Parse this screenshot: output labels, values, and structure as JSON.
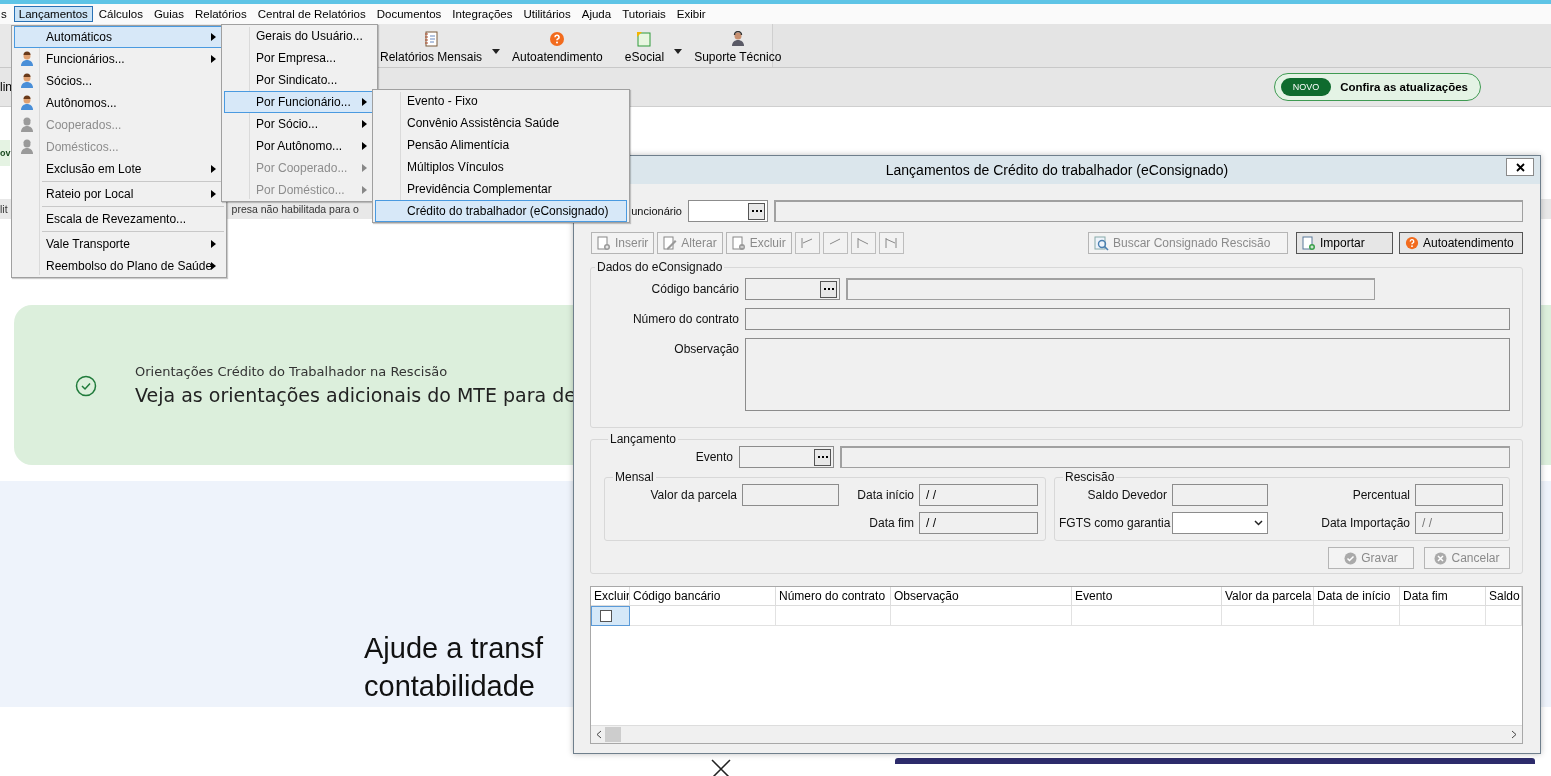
{
  "menubar": [
    {
      "label": "s",
      "selected": false
    },
    {
      "label": "Lançamentos",
      "selected": true
    },
    {
      "label": "Cálculos",
      "selected": false
    },
    {
      "label": "Guias",
      "selected": false
    },
    {
      "label": "Relatórios",
      "selected": false
    },
    {
      "label": "Central de Relatórios",
      "selected": false
    },
    {
      "label": "Documentos",
      "selected": false
    },
    {
      "label": "Integrações",
      "selected": false
    },
    {
      "label": "Utilitários",
      "selected": false
    },
    {
      "label": "Ajuda",
      "selected": false
    },
    {
      "label": "Tutoriais",
      "selected": false
    },
    {
      "label": "Exibir",
      "selected": false
    }
  ],
  "toolbar": [
    {
      "label": "Relatórios Mensais",
      "kind": "report",
      "dropdown": true
    },
    {
      "label": "Autoatendimento",
      "kind": "help",
      "dropdown": false
    },
    {
      "label": "eSocial",
      "kind": "esocial",
      "dropdown": true
    },
    {
      "label": "Suporte Técnico",
      "kind": "support",
      "dropdown": false
    }
  ],
  "info_bar": {
    "left_text": "lin",
    "badge": "NOVO",
    "link": "Confira as atualizações"
  },
  "page": {
    "notice_fragment": "ov",
    "warning_fragments": [
      "lit",
      "presa não habilitada para o"
    ],
    "card": {
      "title": "Orientações Crédito do Trabalhador na Rescisão",
      "text": "Veja as orientações adicionais do MTE para de"
    },
    "promo_lines": [
      "Ajude a transf",
      "contabilidade"
    ]
  },
  "menus": [
    {
      "items": [
        {
          "kind": "item",
          "label": "Automáticos",
          "submenu": true,
          "disabled": false,
          "selected": true
        },
        {
          "kind": "person",
          "label": "Funcionários...",
          "submenu": true,
          "disabled": false,
          "selected": false
        },
        {
          "kind": "person",
          "label": "Sócios...",
          "submenu": false,
          "disabled": false,
          "selected": false
        },
        {
          "kind": "person",
          "label": "Autônomos...",
          "submenu": false,
          "disabled": false,
          "selected": false
        },
        {
          "kind": "person",
          "label": "Cooperados...",
          "submenu": false,
          "disabled": true,
          "selected": false
        },
        {
          "kind": "person",
          "label": "Domésticos...",
          "submenu": false,
          "disabled": true,
          "selected": false
        },
        {
          "kind": "item",
          "label": "Exclusão em Lote",
          "submenu": true,
          "disabled": false,
          "selected": false
        },
        {
          "kind": "separator"
        },
        {
          "kind": "item",
          "label": "Rateio por Local",
          "submenu": true,
          "disabled": false,
          "selected": false
        },
        {
          "kind": "separator"
        },
        {
          "kind": "item",
          "label": "Escala de Revezamento...",
          "submenu": false,
          "disabled": false,
          "selected": false
        },
        {
          "kind": "separator"
        },
        {
          "kind": "item",
          "label": "Vale Transporte",
          "submenu": true,
          "disabled": false,
          "selected": false
        },
        {
          "kind": "item",
          "label": "Reembolso do Plano de Saúde",
          "submenu": true,
          "disabled": false,
          "selected": false
        }
      ]
    },
    {
      "items": [
        {
          "kind": "item",
          "label": "Gerais do Usuário...",
          "submenu": false,
          "disabled": false,
          "selected": false
        },
        {
          "kind": "item",
          "label": "Por Empresa...",
          "submenu": false,
          "disabled": false,
          "selected": false
        },
        {
          "kind": "item",
          "label": "Por Sindicato...",
          "submenu": false,
          "disabled": false,
          "selected": false
        },
        {
          "kind": "item",
          "label": "Por Funcionário...",
          "submenu": true,
          "disabled": false,
          "selected": true
        },
        {
          "kind": "item",
          "label": "Por Sócio...",
          "submenu": true,
          "disabled": false,
          "selected": false
        },
        {
          "kind": "item",
          "label": "Por Autônomo...",
          "submenu": true,
          "disabled": false,
          "selected": false
        },
        {
          "kind": "item",
          "label": "Por Cooperado...",
          "submenu": true,
          "disabled": true,
          "selected": false
        },
        {
          "kind": "item",
          "label": "Por Doméstico...",
          "submenu": true,
          "disabled": true,
          "selected": false
        }
      ]
    },
    {
      "items": [
        {
          "kind": "item",
          "label": "Evento - Fixo",
          "submenu": false,
          "disabled": false,
          "selected": false
        },
        {
          "kind": "item",
          "label": "Convênio Assistência Saúde",
          "submenu": false,
          "disabled": false,
          "selected": false
        },
        {
          "kind": "item",
          "label": "Pensão Alimentícia",
          "submenu": false,
          "disabled": false,
          "selected": false
        },
        {
          "kind": "item",
          "label": "Múltiplos Vínculos",
          "submenu": false,
          "disabled": false,
          "selected": false
        },
        {
          "kind": "item",
          "label": "Previdência Complementar",
          "submenu": false,
          "disabled": false,
          "selected": false
        },
        {
          "kind": "item",
          "label": "Crédito do trabalhador (eConsignado)",
          "submenu": false,
          "disabled": false,
          "selected": true
        }
      ]
    }
  ],
  "dialog": {
    "title": "Lançamentos de Crédito do trabalhador (eConsignado)",
    "employee_label": "uncionário",
    "actions": [
      {
        "label": "Inserir",
        "kind": "insert",
        "disabled": true
      },
      {
        "label": "Alterar",
        "kind": "edit",
        "disabled": true
      },
      {
        "label": "Excluir",
        "kind": "delete",
        "disabled": true
      }
    ],
    "nav_buttons": [
      {
        "kind": "first",
        "disabled": true
      },
      {
        "kind": "prev",
        "disabled": true
      },
      {
        "kind": "next",
        "disabled": true
      },
      {
        "kind": "last",
        "disabled": true
      }
    ],
    "right_actions": [
      {
        "label": "Buscar Consignado Rescisão",
        "kind": "search",
        "disabled": true
      },
      {
        "label": "Importar",
        "kind": "import",
        "disabled": false
      },
      {
        "label": "Autoatendimento",
        "kind": "help",
        "disabled": false
      }
    ],
    "consignado": {
      "title": "Dados do eConsignado",
      "bank_code_label": "Código bancário",
      "contract_label": "Número do contrato",
      "note_label": "Observação"
    },
    "lancamento": {
      "title": "Lançamento",
      "event_label": "Evento",
      "monthly": {
        "title": "Mensal",
        "installment_label": "Valor da parcela",
        "start_label": "Data início",
        "start_value": "/ /",
        "end_label": "Data fim",
        "end_value": "/ /"
      },
      "termination": {
        "title": "Rescisão",
        "balance_label": "Saldo Devedor",
        "percent_label": "Percentual",
        "fgts_label": "FGTS como garantia",
        "import_date_label": "Data Importação",
        "import_date_value": "/ /"
      }
    },
    "form_buttons": [
      {
        "label": "Gravar",
        "kind": "save",
        "disabled": true
      },
      {
        "label": "Cancelar",
        "kind": "cancel",
        "disabled": true
      }
    ],
    "table": {
      "columns": [
        "Excluir",
        "Código bancário",
        "Número do contrato",
        "Observação",
        "Evento",
        "Valor da parcela",
        "Data de início",
        "Data fim",
        "Saldo"
      ],
      "rows": [
        {
          "checked": false,
          "selected": true
        }
      ]
    }
  }
}
